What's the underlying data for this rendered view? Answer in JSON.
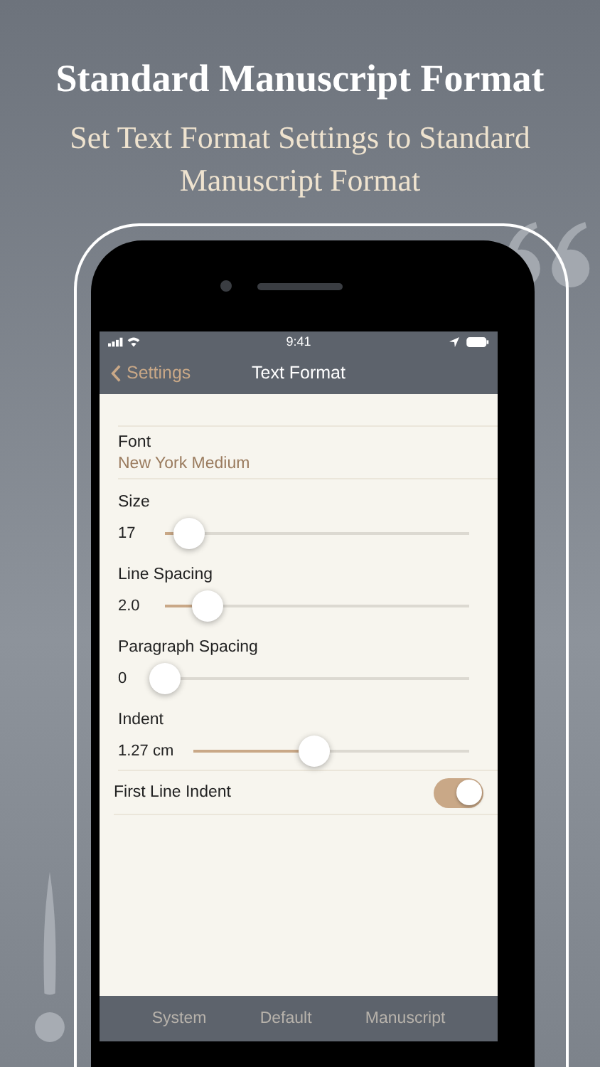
{
  "headline": "Standard Manuscript Format",
  "subtitle": "Set Text Format Settings to Standard Manuscript Format",
  "status_bar": {
    "time": "9:41"
  },
  "nav_bar": {
    "back": "Settings",
    "title": "Text Format"
  },
  "font": {
    "label": "Font",
    "value": "New York Medium"
  },
  "sliders": [
    {
      "label": "Size",
      "reading": "17",
      "level": 0.08
    },
    {
      "label": "Line Spacing",
      "reading": "2.0",
      "level": 0.14
    },
    {
      "label": "Paragraph Spacing",
      "reading": "0",
      "level": 0.0
    },
    {
      "label": "Indent",
      "reading": "1.27 cm",
      "level": 0.44
    }
  ],
  "toggle": {
    "label": "First Line Indent",
    "on": true
  },
  "toolbar": [
    "System",
    "Default",
    "Manuscript"
  ]
}
